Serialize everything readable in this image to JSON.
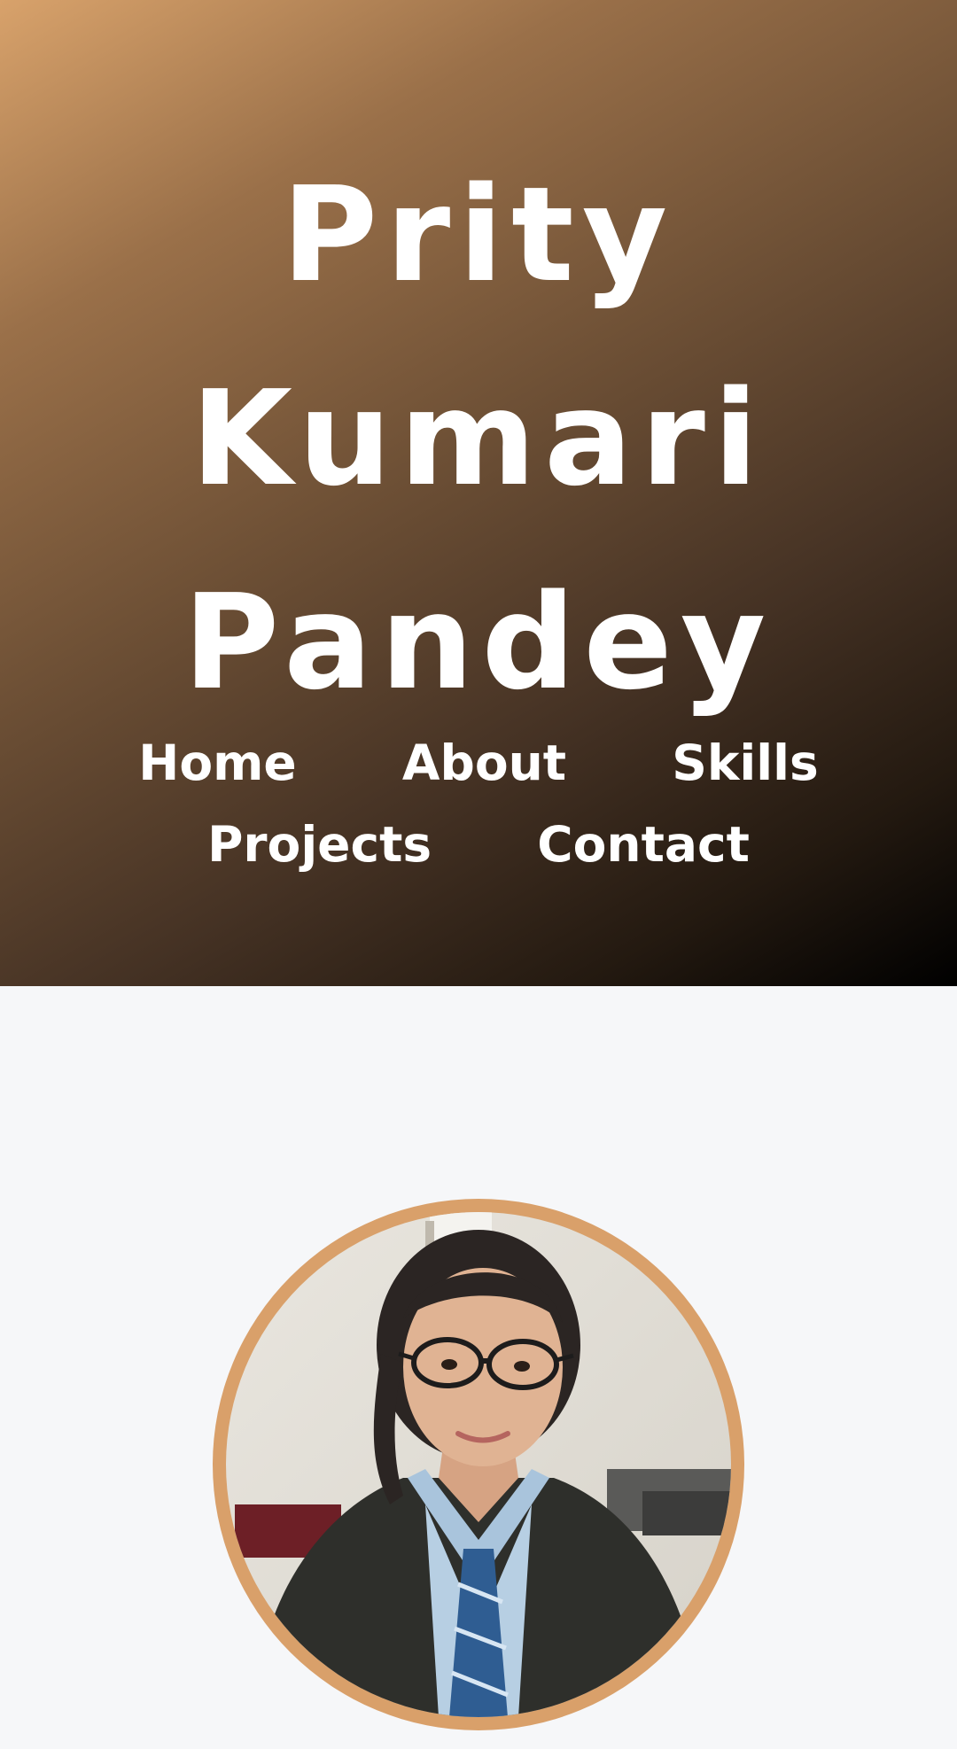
{
  "header": {
    "name_lines": [
      "Prity",
      "Kumari",
      "Pandey"
    ],
    "nav": {
      "home": "Home",
      "about": "About",
      "skills": "Skills",
      "projects": "Projects",
      "contact": "Contact"
    }
  },
  "colors": {
    "accent": "#d9a06a",
    "hero_gradient_start": "#d8a26b",
    "hero_gradient_end": "#000000",
    "page_background": "#f6f7f9",
    "text_on_hero": "#ffffff"
  },
  "profile": {
    "photo_icon": "profile-photo"
  }
}
